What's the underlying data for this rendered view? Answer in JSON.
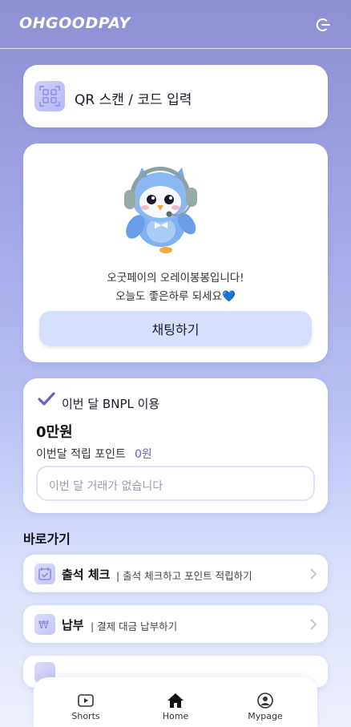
{
  "header": {
    "logo": "OHGOODPAY",
    "logout_icon": "logout-icon"
  },
  "qr": {
    "label": "QR 스캔 / 코드 입력",
    "icon": "qr-scan-icon"
  },
  "chat": {
    "greeting_line1": "오굿페이의 오레이봉봉입니다!",
    "greeting_line2": "오늘도 좋은하루 되세요",
    "greeting_emoji": "💙",
    "button_label": "채팅하기"
  },
  "bnpl": {
    "title": "이번 달 BNPL 이용",
    "amount": "0만원",
    "points_label": "이번달 적립 포인트",
    "points_value": "0원",
    "empty_message": "이번 달 거래가 없습니다"
  },
  "shortcuts": {
    "title": "바로가기",
    "items": [
      {
        "name": "출석 체크",
        "desc": "| 출석 체크하고 포인트 적립하기",
        "icon": "calendar-check-icon"
      },
      {
        "name": "납부",
        "desc": "| 결제 대금 납부하기",
        "icon": "won-payment-icon"
      }
    ]
  },
  "nav": {
    "items": [
      {
        "label": "Shorts",
        "icon": "play-icon"
      },
      {
        "label": "Home",
        "icon": "home-icon"
      },
      {
        "label": "Mypage",
        "icon": "user-icon"
      }
    ]
  },
  "colors": {
    "accent": "#6b5fd0",
    "chat_button": "#d6e0fb",
    "background_top": "#8f8fd4",
    "background_bottom": "#eef1fc"
  }
}
